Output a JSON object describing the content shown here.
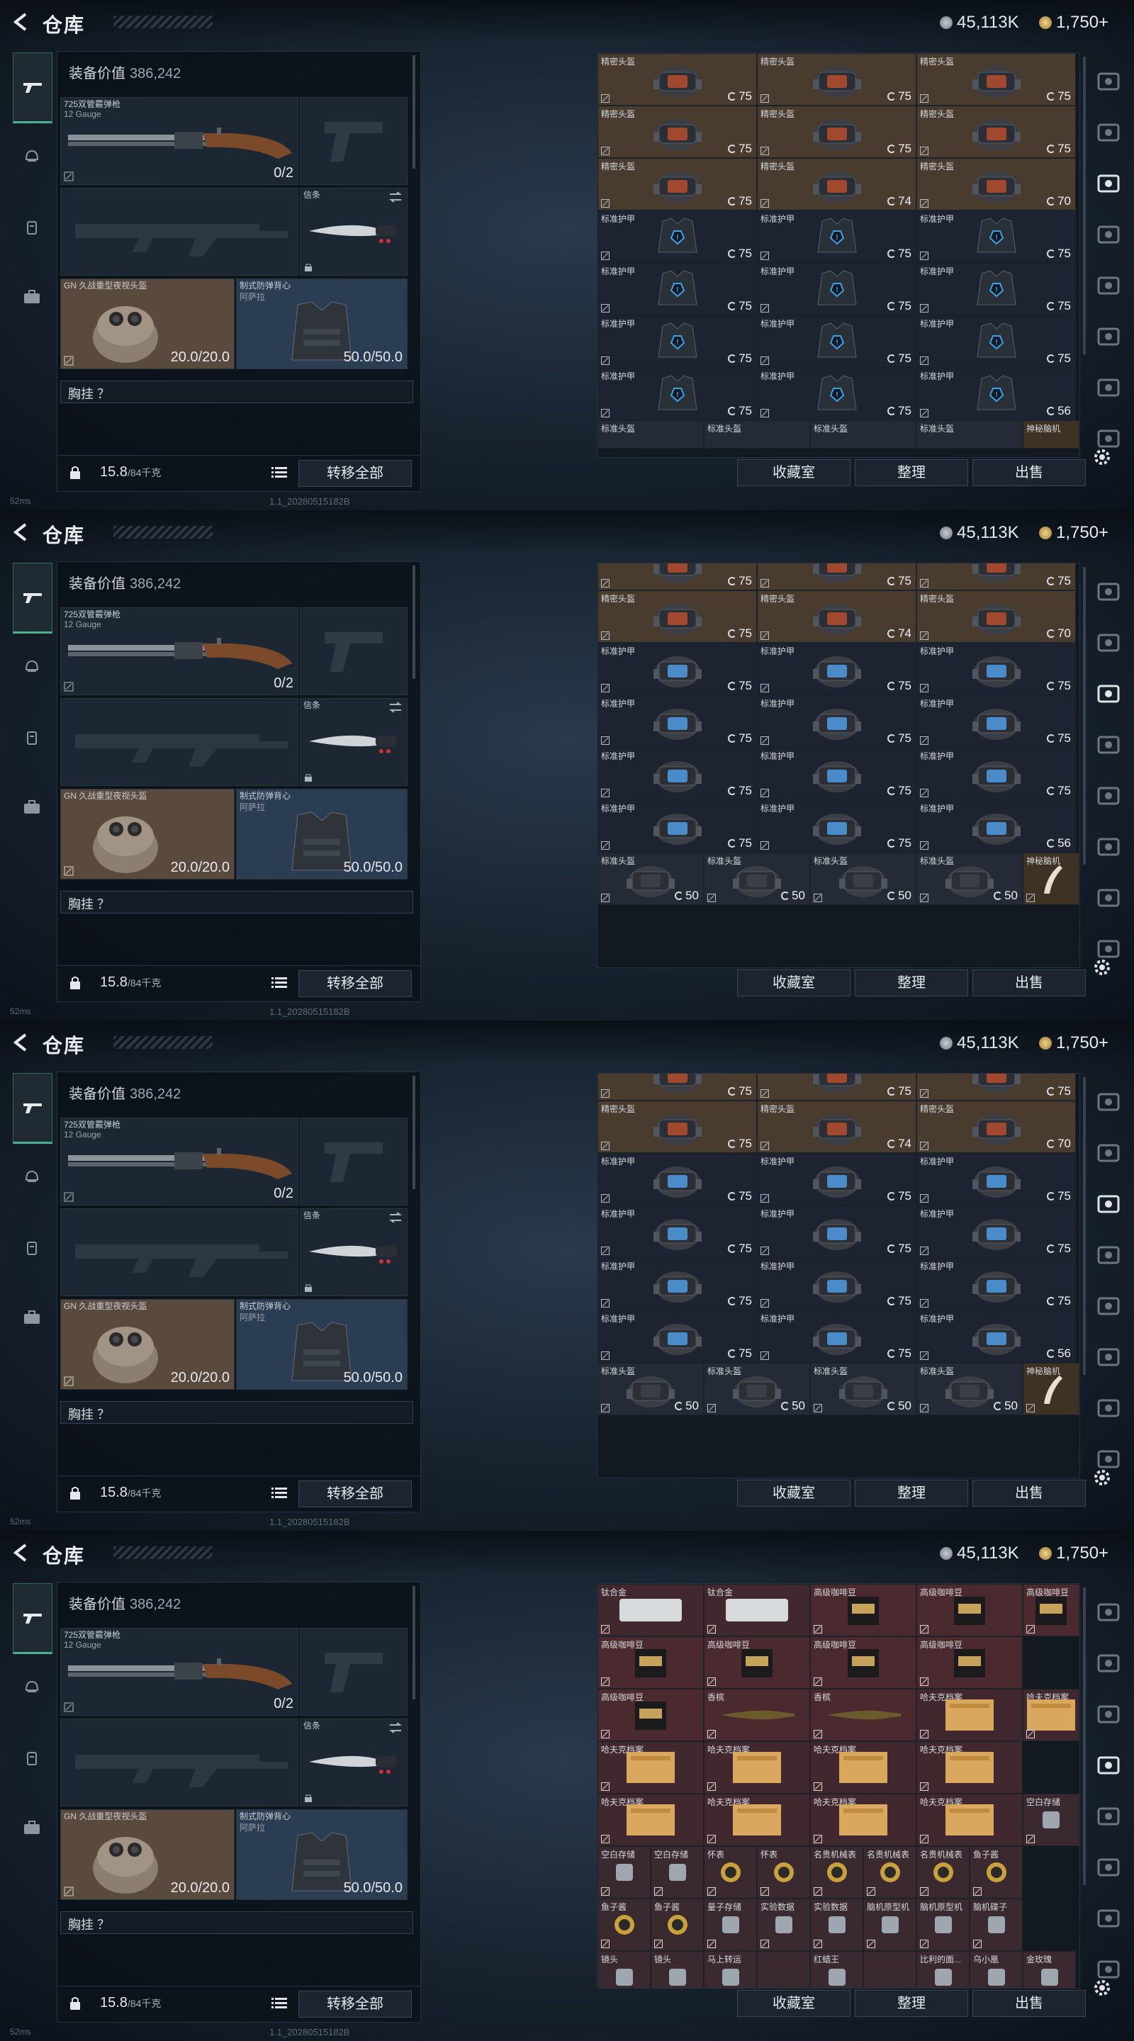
{
  "header": {
    "title": "仓库",
    "currency1": "45,113K",
    "currency2": "1,750+"
  },
  "equipment": {
    "value_label": "装备价值",
    "value": "386,242",
    "primary_weapon": {
      "name": "725双管霰弹枪",
      "sub": "12 Gauge",
      "count": "0/2"
    },
    "melee_label": "信条",
    "helmet": {
      "name": "GN 久战重型夜视头盔",
      "durability": "20.0/20.0"
    },
    "armor": {
      "name": "制式防弹背心",
      "sub": "阿萨拉",
      "durability": "50.0/50.0"
    },
    "chest_rig": "胸挂 ？",
    "weight": "15.8",
    "weight_max": "/84千克",
    "transfer_all": "转移全部"
  },
  "actions": {
    "collection": "收藏室",
    "sort": "整理",
    "sell": "出售"
  },
  "status": {
    "ping": "52ms",
    "version": "1.1_20280515182B"
  },
  "frames": [
    {
      "rows": [
        [
          "精密头盔",
          "75",
          "精密头盔",
          "75",
          "精密头盔",
          "75"
        ],
        [
          "精密头盔",
          "75",
          "精密头盔",
          "75",
          "精密头盔",
          "75"
        ],
        [
          "精密头盔",
          "75",
          "精密头盔",
          "74",
          "精密头盔",
          "70"
        ],
        [
          "标准护甲",
          "75",
          "标准护甲",
          "75",
          "标准护甲",
          "75"
        ],
        [
          "标准护甲",
          "75",
          "标准护甲",
          "75",
          "标准护甲",
          "75"
        ],
        [
          "标准护甲",
          "75",
          "标准护甲",
          "75",
          "标准护甲",
          "75"
        ],
        [
          "标准护甲",
          "75",
          "标准护甲",
          "75",
          "标准护甲",
          "56"
        ]
      ],
      "footer_names": [
        "标准头盔",
        "标准头盔",
        "标准头盔",
        "标准头盔",
        "神秘脑机"
      ]
    },
    {
      "rows": [
        [
          "",
          "75",
          "",
          "75",
          "",
          "75"
        ],
        [
          "精密头盔",
          "75",
          "精密头盔",
          "74",
          "精密头盔",
          "70"
        ],
        [
          "标准护甲",
          "75",
          "标准护甲",
          "75",
          "标准护甲",
          "75"
        ],
        [
          "标准护甲",
          "75",
          "标准护甲",
          "75",
          "标准护甲",
          "75"
        ],
        [
          "标准护甲",
          "75",
          "标准护甲",
          "75",
          "标准护甲",
          "75"
        ],
        [
          "标准护甲",
          "75",
          "标准护甲",
          "75",
          "标准护甲",
          "56"
        ]
      ],
      "bottom_row": [
        [
          "标准头盔",
          "50"
        ],
        [
          "标准头盔",
          "50"
        ],
        [
          "标准头盔",
          "50"
        ],
        [
          "标准头盔",
          "50"
        ],
        [
          "神秘脑机",
          ""
        ]
      ]
    },
    {
      "rows": [
        [
          "",
          "75",
          "",
          "75",
          "",
          "75"
        ],
        [
          "精密头盔",
          "75",
          "精密头盔",
          "74",
          "精密头盔",
          "70"
        ],
        [
          "标准护甲",
          "75",
          "标准护甲",
          "75",
          "标准护甲",
          "75"
        ],
        [
          "标准护甲",
          "75",
          "标准护甲",
          "75",
          "标准护甲",
          "75"
        ],
        [
          "标准护甲",
          "75",
          "标准护甲",
          "75",
          "标准护甲",
          "75"
        ],
        [
          "标准护甲",
          "75",
          "标准护甲",
          "75",
          "标准护甲",
          "56"
        ]
      ],
      "bottom_row": [
        [
          "标准头盔",
          "50"
        ],
        [
          "标准头盔",
          "50"
        ],
        [
          "标准头盔",
          "50"
        ],
        [
          "标准头盔",
          "50"
        ],
        [
          "神秘脑机",
          ""
        ]
      ]
    },
    {
      "misc_rows": [
        [
          "钛合金",
          "钛合金",
          "高级咖啡豆",
          "高级咖啡豆",
          "高级咖啡豆"
        ],
        [
          "高级咖啡豆",
          "高级咖啡豆",
          "高级咖啡豆",
          "高级咖啡豆",
          ""
        ],
        [
          "高级咖啡豆",
          "香槟",
          "香槟",
          "哈夫克档案",
          "哈夫克档案"
        ],
        [
          "哈夫克档案",
          "哈夫克档案",
          "哈夫克档案",
          "哈夫克档案",
          ""
        ],
        [
          "哈夫克档案",
          "哈夫克档案",
          "哈夫克档案",
          "哈夫克档案",
          "空白存储"
        ],
        [
          "空白存储",
          "空白存储",
          "怀表",
          "怀表",
          "名贵机械表",
          "名贵机械表",
          "名贵机械表",
          "鱼子酱"
        ],
        [
          "鱼子酱",
          "鱼子酱",
          "量子存储",
          "实验数据",
          "实验数据",
          "脑机原型机",
          "脑机原型机",
          "脑机碟子"
        ],
        [
          "镜头",
          "镜头",
          "马上转运",
          "",
          "红蜡王",
          "",
          "比利的面...",
          "乌小凰",
          "金玫瑰"
        ]
      ]
    }
  ]
}
